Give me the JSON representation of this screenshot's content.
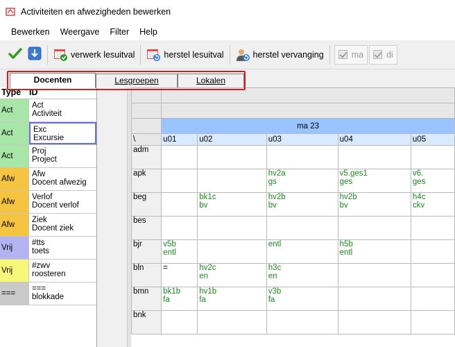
{
  "window": {
    "title": "Activiteiten en afwezigheden bewerken"
  },
  "menu": [
    "Bewerken",
    "Weergave",
    "Filter",
    "Help"
  ],
  "toolbar": {
    "verwerk_label": "verwerk lesuitval",
    "herstel_label": "herstel lesuitval",
    "vervanging_label": "herstel vervanging",
    "checks": [
      {
        "label": "ma",
        "checked": true
      },
      {
        "label": "di",
        "checked": true
      }
    ]
  },
  "tabs": [
    {
      "label": "Docenten",
      "active": true
    },
    {
      "label": "Lesgroepen",
      "active": false
    },
    {
      "label": "Lokalen",
      "active": false
    }
  ],
  "types": {
    "header": {
      "type": "Type",
      "id": "ID"
    },
    "rows": [
      {
        "type": "Act",
        "id1": "Act",
        "id2": "Activiteit",
        "color": "#a8e6a8"
      },
      {
        "type": "Act",
        "id1": "Exc",
        "id2": "Excursie",
        "color": "#a8e6a8",
        "selected": true
      },
      {
        "type": "Act",
        "id1": "Proj",
        "id2": "Project",
        "color": "#a8e6a8"
      },
      {
        "type": "Afw",
        "id1": "Afw",
        "id2": "Docent afwezig",
        "color": "#f5c542"
      },
      {
        "type": "Afw",
        "id1": "Verlof",
        "id2": "Docent verlof",
        "color": "#f5c542"
      },
      {
        "type": "Afw",
        "id1": "Ziek",
        "id2": "Docent ziek",
        "color": "#f5c542"
      },
      {
        "type": "Vrij",
        "id1": "#tts",
        "id2": "toets",
        "color": "#b3b3f2"
      },
      {
        "type": "Vrij",
        "id1": "#zwv",
        "id2": "roosteren",
        "color": "#f7f77a"
      },
      {
        "type": "===",
        "id1": "===",
        "id2": "blokkade",
        "color": "#c9c9c9"
      }
    ]
  },
  "grid": {
    "day": "ma 23",
    "corner": "\\",
    "periods": [
      "u01",
      "u02",
      "u03",
      "u04",
      "u05"
    ],
    "rows": [
      {
        "code": "adm",
        "cells": [
          [
            "",
            ""
          ],
          [
            "",
            ""
          ],
          [
            "",
            ""
          ],
          [
            "",
            ""
          ],
          [
            "",
            ""
          ]
        ]
      },
      {
        "code": "apk",
        "cells": [
          [
            "",
            ""
          ],
          [
            "",
            ""
          ],
          [
            "hv2a",
            "gs"
          ],
          [
            "v5.ges1",
            "ges"
          ],
          [
            "v6.",
            "ges"
          ]
        ]
      },
      {
        "code": "beg",
        "cells": [
          [
            "",
            ""
          ],
          [
            "bk1c",
            "bv"
          ],
          [
            "hv2b",
            "bv"
          ],
          [
            "hv2b",
            "bv"
          ],
          [
            "h4c",
            "ckv"
          ]
        ]
      },
      {
        "code": "bes",
        "cells": [
          [
            "",
            ""
          ],
          [
            "",
            ""
          ],
          [
            "",
            ""
          ],
          [
            "",
            ""
          ],
          [
            "",
            ""
          ]
        ]
      },
      {
        "code": "bjr",
        "cells": [
          [
            "v5b",
            "entl"
          ],
          [
            "",
            ""
          ],
          [
            "",
            "entl"
          ],
          [
            "h5b",
            "entl"
          ],
          [
            "",
            ""
          ]
        ]
      },
      {
        "code": "bln",
        "cells": [
          [
            "=",
            ""
          ],
          [
            "hv2c",
            "en"
          ],
          [
            "h3c",
            "en"
          ],
          [
            "",
            ""
          ],
          [
            "",
            ""
          ]
        ]
      },
      {
        "code": "bmn",
        "cells": [
          [
            "bk1b",
            "fa"
          ],
          [
            "hv1b",
            "fa"
          ],
          [
            "v3b",
            "fa"
          ],
          [
            "",
            ""
          ],
          [
            "",
            ""
          ]
        ]
      },
      {
        "code": "bnk",
        "cells": [
          [
            "",
            ""
          ],
          [
            "",
            ""
          ],
          [
            "",
            ""
          ],
          [
            "",
            ""
          ],
          [
            "",
            ""
          ]
        ]
      }
    ]
  },
  "colors": {
    "accent_red": "#e3141b",
    "day_header": "#99c4ff",
    "period_header": "#d9e9ff",
    "cell_text": "#1b8a1b"
  }
}
